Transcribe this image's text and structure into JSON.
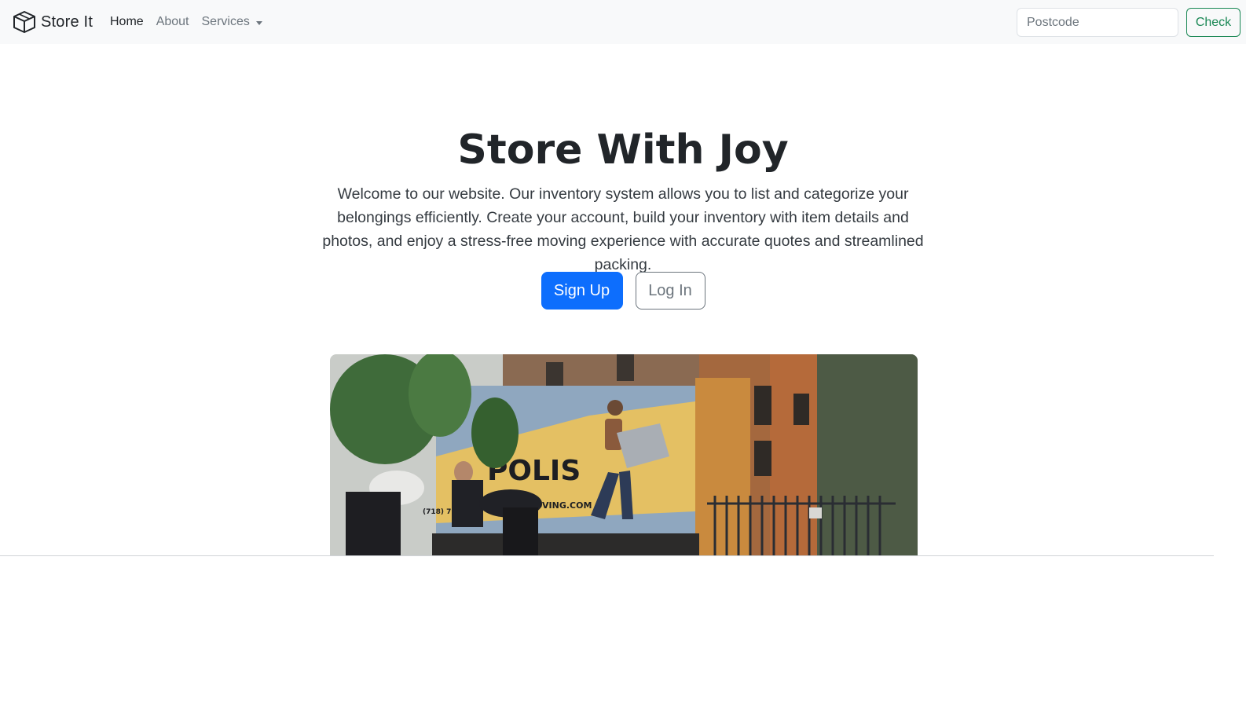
{
  "navbar": {
    "brand": {
      "name": "Store It",
      "icon": "box-icon"
    },
    "links": [
      {
        "label": "Home",
        "active": true
      },
      {
        "label": "About",
        "active": false
      },
      {
        "label": "Services",
        "active": false,
        "dropdown": true
      }
    ],
    "search": {
      "placeholder": "Postcode",
      "value": ""
    },
    "check_button": "Check"
  },
  "hero": {
    "title": "Store With Joy",
    "lead": "Welcome to our website. Our inventory system allows you to list and categorize your belongings efficiently. Create your account, build your inventory with item details and photos, and enjoy a stress-free moving experience with accurate quotes and streamlined packing.",
    "buttons": {
      "signup": "Sign Up",
      "login": "Log In"
    }
  },
  "image": {
    "truck_text": "POLIS",
    "truck_url": "MOVING.COM",
    "truck_phone": "(718) 7..520 •"
  },
  "colors": {
    "primary": "#0d6efd",
    "success": "#198754",
    "navbar_bg": "#f8f9fa",
    "secondary": "#6c757d"
  }
}
